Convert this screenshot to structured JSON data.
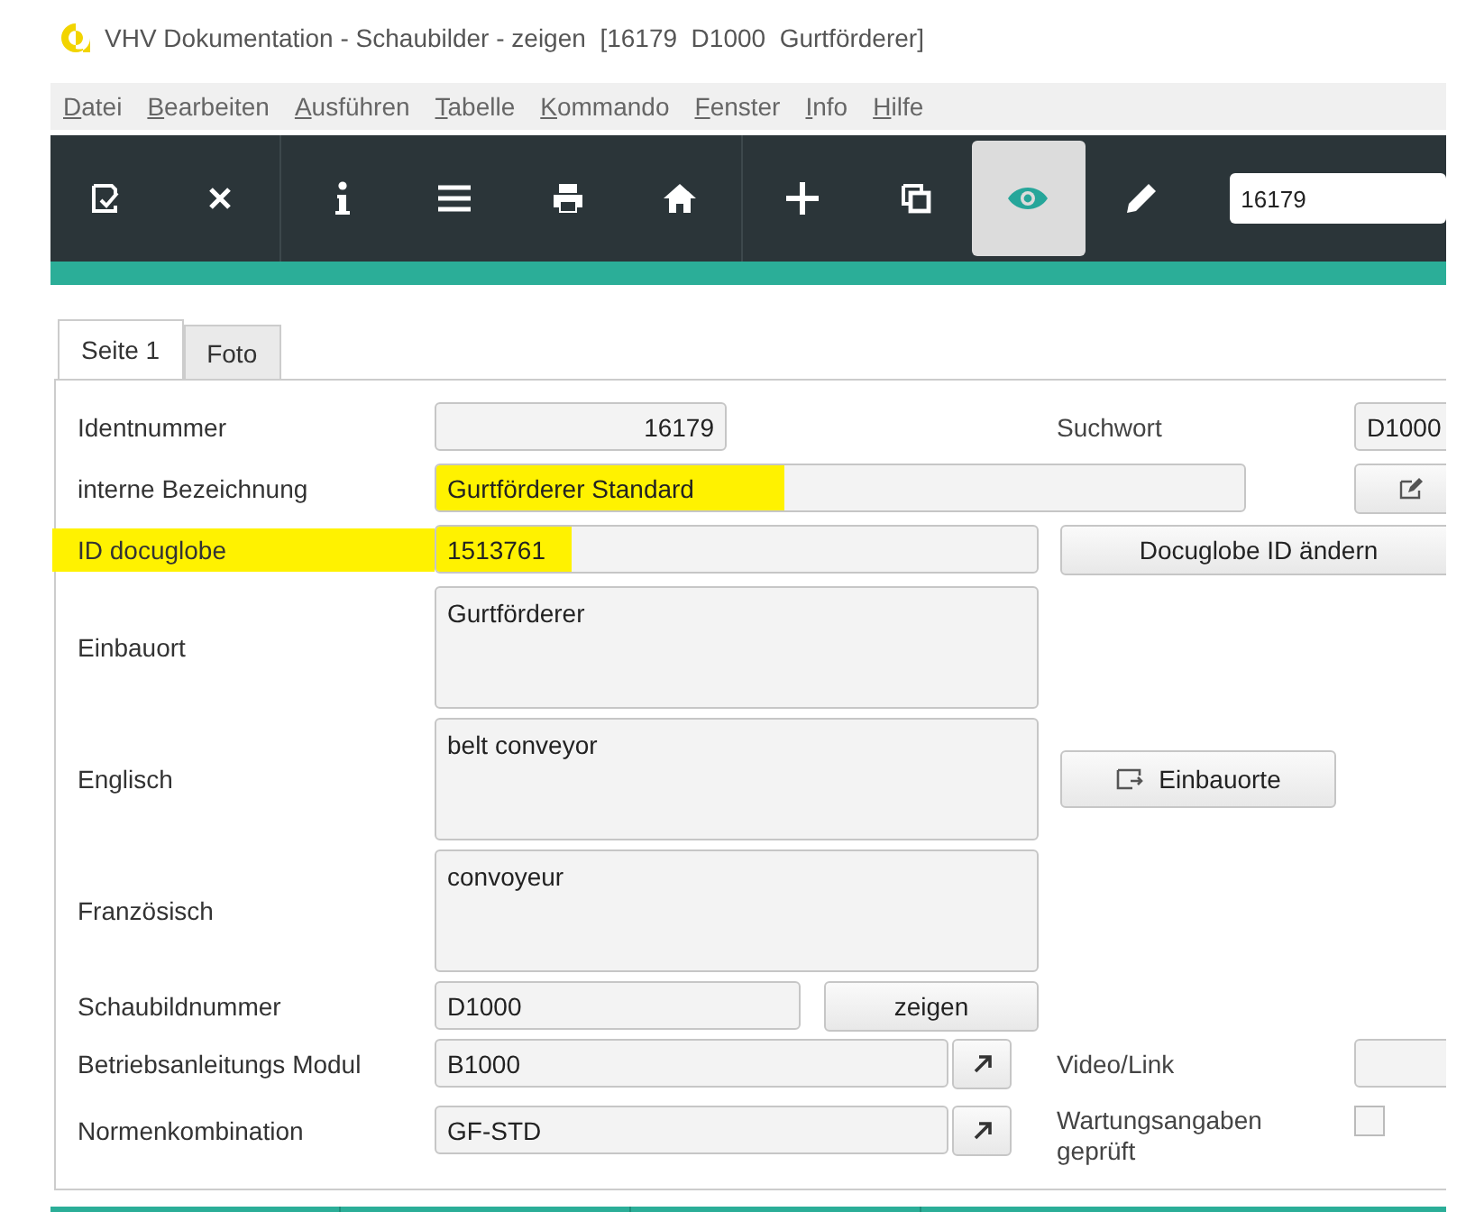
{
  "window": {
    "title": "VHV Dokumentation - Schaubilder - zeigen  [16179  D1000  Gurtförderer]"
  },
  "menu": [
    "Datei",
    "Bearbeiten",
    "Ausführen",
    "Tabelle",
    "Kommando",
    "Fenster",
    "Info",
    "Hilfe"
  ],
  "toolbar": {
    "buttons": [
      {
        "kind": "save",
        "selected": false
      },
      {
        "kind": "close",
        "selected": false
      },
      {
        "kind": "info",
        "selected": false
      },
      {
        "kind": "list",
        "selected": false
      },
      {
        "kind": "print",
        "selected": false
      },
      {
        "kind": "home",
        "selected": false
      },
      {
        "kind": "add",
        "selected": false
      },
      {
        "kind": "copy",
        "selected": false
      },
      {
        "kind": "view",
        "selected": true
      },
      {
        "kind": "edit",
        "selected": false
      }
    ],
    "search": {
      "value": "16179"
    }
  },
  "tabs": [
    {
      "label": "Seite 1",
      "selected": true
    },
    {
      "label": "Foto",
      "selected": false
    }
  ],
  "form": {
    "identnummer": {
      "label": "Identnummer",
      "value": "16179"
    },
    "suchwort": {
      "label": "Suchwort",
      "value": "D1000"
    },
    "bezeichnung": {
      "label": "interne Bezeichnung",
      "value": "Gurtförderer Standard",
      "value_highlighted": true
    },
    "docuglobe": {
      "label": "ID docuglobe",
      "value": "1513761",
      "label_highlighted": true,
      "value_highlighted": true
    },
    "docuglobe_button": "Docuglobe ID ändern",
    "einbauort": {
      "label": "Einbauort",
      "value": "Gurtförderer"
    },
    "englisch": {
      "label": "Englisch",
      "value": "belt conveyor"
    },
    "einbauorte_button": "Einbauorte",
    "franzoesisch": {
      "label": "Französisch",
      "value": "convoyeur"
    },
    "schaubildnummer": {
      "label": "Schaubildnummer",
      "value": "D1000"
    },
    "zeigen_button": "zeigen",
    "betriebsanleitung": {
      "label": "Betriebsanleitungs Modul",
      "value": "B1000"
    },
    "video_link": {
      "label": "Video/Link"
    },
    "normenkombination": {
      "label": "Normenkombination",
      "value": "GF-STD"
    },
    "wartung": {
      "label": "Wartungsangaben geprüft",
      "checked": false
    }
  }
}
